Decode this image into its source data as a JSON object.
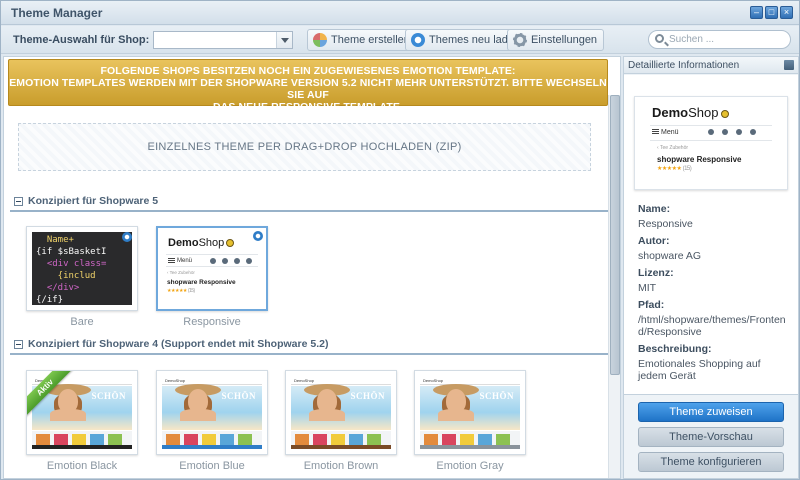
{
  "window": {
    "title": "Theme Manager"
  },
  "toolbar": {
    "shop_label": "Theme-Auswahl für Shop:",
    "shop_value": "",
    "create_label": "Theme erstellen",
    "reload_label": "Themes neu laden",
    "settings_label": "Einstellungen",
    "search_placeholder": "Suchen ..."
  },
  "alert": {
    "line1": "FOLGENDE SHOPS BESITZEN NOCH EIN ZUGEWIESENES EMOTION TEMPLATE:",
    "line2": "EMOTION TEMPLATES WERDEN MIT DER SHOPWARE VERSION 5.2 NICHT MEHR UNTERSTÜTZT. BITTE WECHSELN SIE AUF",
    "line3": "DAS NEUE RESPONSIVE TEMPLATE."
  },
  "upload": {
    "label": "EINZELNES THEME PER DRAG+DROP HOCHLADEN (ZIP)"
  },
  "sections": [
    {
      "title": "Konzipiert für Shopware 5",
      "themes": [
        {
          "name": "Bare"
        },
        {
          "name": "Responsive"
        }
      ]
    },
    {
      "title": "Konzipiert für Shopware 4 (Support endet mit Shopware 5.2)",
      "themes": [
        {
          "name": "Emotion Black",
          "badge": "Aktiv"
        },
        {
          "name": "Emotion Blue"
        },
        {
          "name": "Emotion Brown"
        },
        {
          "name": "Emotion Gray"
        }
      ]
    }
  ],
  "bare_code": {
    "l1": "  Name+",
    "l2": "{if $sBasketI",
    "l3": "  <div class=",
    "l4": "    {includ",
    "l5": "  </div>",
    "l6": "{/if}"
  },
  "shop_preview": {
    "logo_bold": "Demo",
    "logo_light": "Shop",
    "menu": "Menü",
    "crumb": "‹  Tee Zubehör",
    "product": "shopware Responsive",
    "stars": "★★★★★",
    "rating_count": "(15)"
  },
  "emotion_preview": {
    "logo": "DemoShop",
    "banner_text": "SCHÖN"
  },
  "sidebar": {
    "title": "Detaillierte Informationen",
    "fields": [
      {
        "key": "Name:",
        "value": "Responsive"
      },
      {
        "key": "Autor:",
        "value": "shopware AG"
      },
      {
        "key": "Lizenz:",
        "value": "MIT"
      },
      {
        "key": "Pfad:",
        "value": "/html/shopware/themes/Frontend/Responsive"
      },
      {
        "key": "Beschreibung:",
        "value": "Emotionales Shopping auf jedem Gerät"
      }
    ],
    "assign_label": "Theme zuweisen",
    "preview_label": "Theme-Vorschau",
    "configure_label": "Theme konfigurieren"
  },
  "colors": {
    "accent": "#1f73c7",
    "alert": "#c99d2c",
    "active_badge": "#4b9c2b"
  }
}
